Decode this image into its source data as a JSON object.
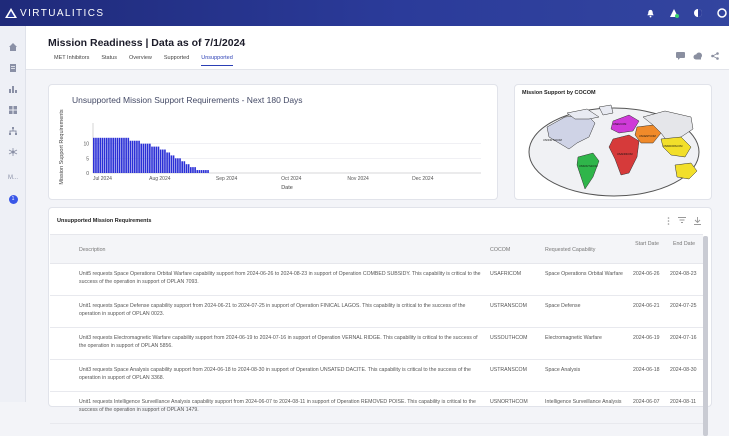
{
  "app": {
    "logo_text": "VIRTUALITICS"
  },
  "header": {
    "title": "Mission Readiness | Data as of 7/1/2024",
    "tabs": [
      {
        "label": "MET Inhibitors",
        "active": false
      },
      {
        "label": "Status",
        "active": false
      },
      {
        "label": "Overview",
        "active": false
      },
      {
        "label": "Supported",
        "active": false
      },
      {
        "label": "Unsupported",
        "active": true
      }
    ]
  },
  "leftnav": {
    "label_m": "M...",
    "badge": "1"
  },
  "chart_data": {
    "type": "bar",
    "title": "Unsupported Mission Support Requirements - Next 180 Days",
    "xlabel": "Date",
    "ylabel": "Mission Support Requirements",
    "ylim": [
      0,
      15
    ],
    "yticks": [
      0,
      5,
      10
    ],
    "xticks": [
      "Jul 2024",
      "Aug 2024",
      "Sep 2024",
      "Oct 2024",
      "Nov 2024",
      "Dec 2024"
    ],
    "x_start": "2024-07-01",
    "x_end": "2024-12-28",
    "series": [
      {
        "color": "#2a2fd6",
        "values": [
          12,
          12,
          12,
          12,
          12,
          12,
          12,
          12,
          12,
          12,
          12,
          12,
          12,
          12,
          12,
          12,
          12,
          11,
          11,
          11,
          11,
          11,
          10,
          10,
          10,
          10,
          10,
          9,
          9,
          9,
          9,
          8,
          8,
          8,
          7,
          7,
          6,
          6,
          5,
          5,
          5,
          4,
          4,
          3,
          3,
          2,
          2,
          2,
          1,
          1,
          1,
          1,
          1,
          1
        ]
      }
    ]
  },
  "map": {
    "title": "Mission Support by COCOM",
    "labels": [
      "USNORTHCOM",
      "USEUCOM",
      "USINDOPACOM",
      "USSOUTHCOM",
      "USAFRICOM",
      "USCENTCOM"
    ]
  },
  "table": {
    "title": "Unsupported Mission Requirements",
    "columns": {
      "description": "Description",
      "cocom": "COCOM",
      "capability": "Requested Capability",
      "start": "Start Date",
      "end": "End Date"
    },
    "rows": [
      {
        "description": "Unit5 requests Space Operations Orbital Warfare capability support from 2024-06-26 to 2024-08-23 in support of Operation COMBED SUBSIDY. This capability is critical to the success of the operation in support of OPLAN 7093.",
        "cocom": "USAFRICOM",
        "capability": "Space Operations Orbital Warfare",
        "start": "2024-06-26",
        "end": "2024-08-23"
      },
      {
        "description": "Unit1 requests Space Defense capability support from 2024-06-21 to 2024-07-25 in support of Operation FINICAL LAGOS. This capability is critical to the success of the operation in support of OPLAN 0023.",
        "cocom": "USTRANSCOM",
        "capability": "Space Defense",
        "start": "2024-06-21",
        "end": "2024-07-25"
      },
      {
        "description": "Unit3 requests Electromagnetic Warfare capability support from 2024-06-19 to 2024-07-16 in support of Operation VERNAL RIDGE. This capability is critical to the success of the operation in support of OPLAN 5856.",
        "cocom": "USSOUTHCOM",
        "capability": "Electromagnetic Warfare",
        "start": "2024-06-19",
        "end": "2024-07-16"
      },
      {
        "description": "Unit3 requests Space Analysis capability support from 2024-06-18 to 2024-08-30 in support of Operation UNSATED DACITE. This capability is critical to the success of the operation in support of OPLAN 3368.",
        "cocom": "USTRANSCOM",
        "capability": "Space Analysis",
        "start": "2024-06-18",
        "end": "2024-08-30"
      },
      {
        "description": "Unit1 requests Intelligence Surveillance Analysis capability support from 2024-06-07 to 2024-08-11 in support of Operation REMOVED POISE. This capability is critical to the success of the operation in support of OPLAN 1479.",
        "cocom": "USNORTHCOM",
        "capability": "Intelligence Surveillance Analysis",
        "start": "2024-06-07",
        "end": "2024-08-11"
      }
    ]
  }
}
